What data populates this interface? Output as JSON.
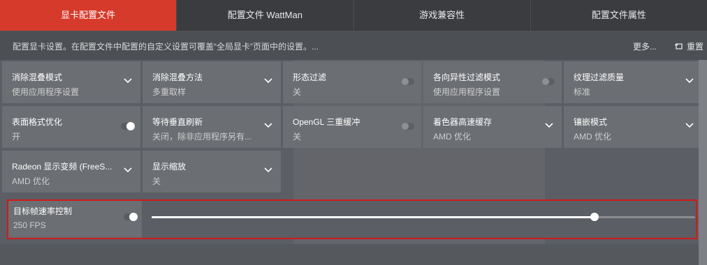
{
  "tabs": [
    {
      "label": "显卡配置文件",
      "active": true
    },
    {
      "label": "配置文件 WattMan",
      "active": false
    },
    {
      "label": "游戏兼容性",
      "active": false
    },
    {
      "label": "配置文件属性",
      "active": false
    }
  ],
  "description": "配置显卡设置。在配置文件中配置的自定义设置可覆盖“全局显卡”页面中的设置。...",
  "actions": {
    "more": "更多...",
    "reset": "重置"
  },
  "settings": [
    {
      "title": "消除混叠模式",
      "value": "使用应用程序设置",
      "control": "dropdown"
    },
    {
      "title": "消除混叠方法",
      "value": "多重取样",
      "control": "dropdown"
    },
    {
      "title": "形态过滤",
      "value": "关",
      "control": "toggle",
      "on": false
    },
    {
      "title": "各向异性过滤模式",
      "value": "使用应用程序设置",
      "control": "toggle",
      "on": false
    },
    {
      "title": "纹理过滤质量",
      "value": "标准",
      "control": "dropdown"
    },
    {
      "title": "表面格式优化",
      "value": "开",
      "control": "toggle",
      "on": true
    },
    {
      "title": "等待垂直刷新",
      "value": "关闭，除非应用程序另有...",
      "control": "dropdown"
    },
    {
      "title": "OpenGL 三重缓冲",
      "value": "关",
      "control": "toggle",
      "on": false
    },
    {
      "title": "着色器高速缓存",
      "value": "AMD 优化",
      "control": "dropdown"
    },
    {
      "title": "镶嵌模式",
      "value": "AMD 优化",
      "control": "dropdown"
    },
    {
      "title": "Radeon 显示变频 (FreeS...",
      "value": "AMD 优化",
      "control": "dropdown"
    },
    {
      "title": "显示缩放",
      "value": "关",
      "control": "dropdown"
    }
  ],
  "frame_rate_control": {
    "title": "目标帧速率控制",
    "value": "250 FPS",
    "on": true,
    "slider_fraction": 0.815
  },
  "colors": {
    "accent": "#d63a2a",
    "highlight_box": "#d11a1a"
  }
}
